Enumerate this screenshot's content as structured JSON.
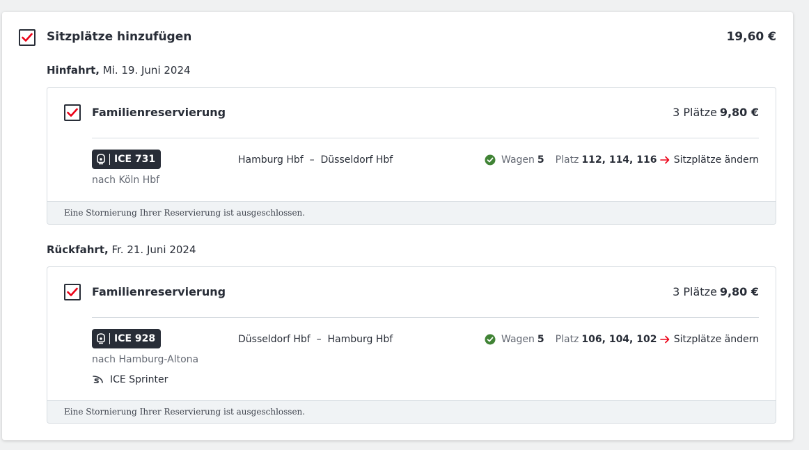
{
  "section": {
    "title": "Sitzplätze hinzufügen",
    "price": "19,60 €",
    "checked": true
  },
  "outbound": {
    "label": "Hinfahrt,",
    "date": " Mi. 19. Juni 2024",
    "card": {
      "title": "Familienreservierung",
      "seats_count": "3 Plätze",
      "price": "9,80 €",
      "train": "ICE 731",
      "destination": "nach Köln Hbf",
      "from": "Hamburg Hbf",
      "dash": "–",
      "to": "Düsseldorf Hbf",
      "wagen_label": "Wagen",
      "wagen": "5",
      "platz_label": "Platz",
      "platz": "112, 114, 116",
      "change_label": "Sitzplätze ändern",
      "footer": "Eine Stornierung Ihrer Reservierung ist ausgeschlossen."
    }
  },
  "return": {
    "label": "Rückfahrt,",
    "date": " Fr. 21. Juni 2024",
    "card": {
      "title": "Familienreservierung",
      "seats_count": "3 Plätze",
      "price": "9,80 €",
      "train": "ICE 928",
      "destination": "nach Hamburg-Altona",
      "sprinter": "ICE Sprinter",
      "from": "Düsseldorf Hbf",
      "dash": "–",
      "to": "Hamburg Hbf",
      "wagen_label": "Wagen",
      "wagen": "5",
      "platz_label": "Platz",
      "platz": "106, 104, 102",
      "change_label": "Sitzplätze ändern",
      "footer": "Eine Stornierung Ihrer Reservierung ist ausgeschlossen."
    }
  },
  "colors": {
    "accent_red": "#ec0016",
    "success_green": "#408335",
    "text_dark": "#282d37"
  }
}
